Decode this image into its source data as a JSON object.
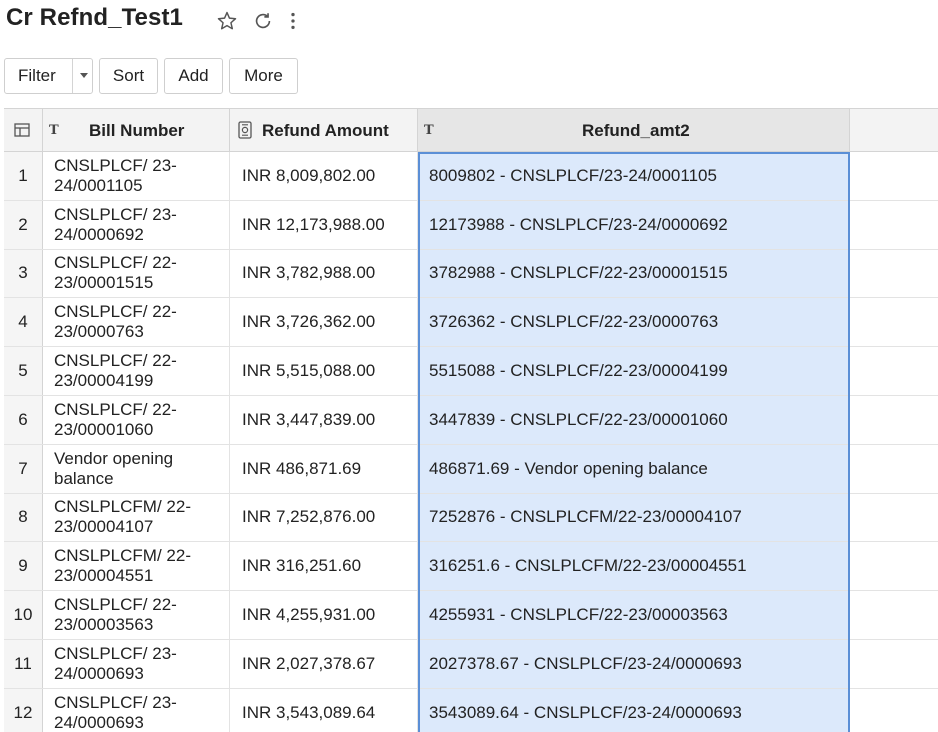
{
  "header": {
    "title": "Cr Refnd_Test1",
    "icons": [
      "star-icon",
      "refresh-icon",
      "more-vertical-icon"
    ]
  },
  "toolbar": {
    "filter_label": "Filter",
    "sort_label": "Sort",
    "add_label": "Add",
    "more_label": "More"
  },
  "table": {
    "columns": [
      {
        "label": "Bill Number",
        "type_icon": "T"
      },
      {
        "label": "Refund Amount",
        "type_icon": "currency-icon"
      },
      {
        "label": "Refund_amt2",
        "type_icon": "T"
      }
    ],
    "rows": [
      {
        "index": "1",
        "bill": "CNSLPLCF/ 23-24/0001105",
        "amount": "INR 8,009,802.00",
        "amt2": "8009802  - CNSLPLCF/23-24/0001105"
      },
      {
        "index": "2",
        "bill": "CNSLPLCF/ 23-24/0000692",
        "amount": "INR 12,173,988.00",
        "amt2": "12173988  - CNSLPLCF/23-24/0000692"
      },
      {
        "index": "3",
        "bill": "CNSLPLCF/ 22-23/00001515",
        "amount": "INR 3,782,988.00",
        "amt2": "3782988  - CNSLPLCF/22-23/00001515"
      },
      {
        "index": "4",
        "bill": "CNSLPLCF/ 22-23/0000763",
        "amount": "INR 3,726,362.00",
        "amt2": "3726362  - CNSLPLCF/22-23/0000763"
      },
      {
        "index": "5",
        "bill": "CNSLPLCF/ 22-23/00004199",
        "amount": "INR 5,515,088.00",
        "amt2": "5515088  - CNSLPLCF/22-23/00004199"
      },
      {
        "index": "6",
        "bill": "CNSLPLCF/ 22-23/00001060",
        "amount": "INR 3,447,839.00",
        "amt2": "3447839  - CNSLPLCF/22-23/00001060"
      },
      {
        "index": "7",
        "bill": "Vendor opening balance",
        "amount": "INR 486,871.69",
        "amt2": "486871.69  - Vendor opening balance"
      },
      {
        "index": "8",
        "bill": "CNSLPLCFM/ 22-23/00004107",
        "amount": "INR 7,252,876.00",
        "amt2": "7252876  - CNSLPLCFM/22-23/00004107"
      },
      {
        "index": "9",
        "bill": "CNSLPLCFM/ 22-23/00004551",
        "amount": "INR 316,251.60",
        "amt2": "316251.6  - CNSLPLCFM/22-23/00004551"
      },
      {
        "index": "10",
        "bill": "CNSLPLCF/ 22-23/00003563",
        "amount": "INR 4,255,931.00",
        "amt2": "4255931  - CNSLPLCF/22-23/00003563"
      },
      {
        "index": "11",
        "bill": "CNSLPLCF/ 23-24/0000693",
        "amount": "INR 2,027,378.67",
        "amt2": "2027378.67  - CNSLPLCF/23-24/0000693"
      },
      {
        "index": "12",
        "bill": "CNSLPLCF/ 23-24/0000693",
        "amount": "INR 3,543,089.64",
        "amt2": "3543089.64  - CNSLPLCF/23-24/0000693"
      }
    ]
  },
  "colors": {
    "selected_column_bg": "#dce9fb",
    "selection_border": "#5b8fd6",
    "header_bg": "#f3f3f3"
  }
}
